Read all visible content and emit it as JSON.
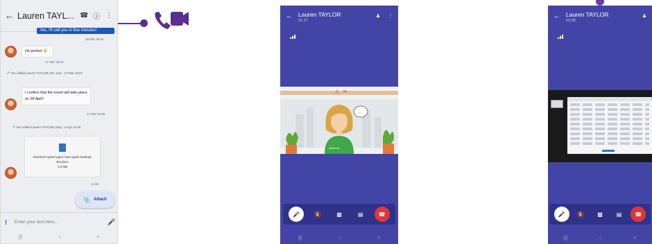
{
  "colors": {
    "brand_purple": "#5b2e91",
    "call_background": "#4345a6",
    "hangup_red": "#e0353b",
    "accent_blue": "#1d57b8"
  },
  "chat_screen": {
    "header": {
      "title": "Lauren TAYL...",
      "icons": [
        "back-arrow-icon",
        "video-call-icon",
        "info-icon",
        "more-vert-icon"
      ]
    },
    "messages": {
      "outgoing_top": "Yes, I'll call you in five minutes!",
      "outgoing_top_time": "16 Mar 16:31",
      "msg1_text": "Ok perfect",
      "msg1_time": "17 Mar 18:42",
      "sys1": "You called Lauren TAYLOR (3m 12s) - 17 Mar 15:57",
      "msg2_text": "I confirm that the event will take place on 28 April!",
      "msg2_time": "17 Mar 15:58",
      "sys2": "You called Lauren TAYLOR (16s) - 5 Apr 14:16",
      "file_name": "Rainbow hybrid quick start guide desktop EN.docx",
      "file_size": "1.5 MB",
      "file_time": "11:38"
    },
    "attach_label": "Attach",
    "composer_placeholder": "Enter your text here..."
  },
  "callout": {
    "icon": "video-call-icon"
  },
  "video_call_screen": {
    "name": "Lauren TAYLOR",
    "duration": "01:27",
    "video_label": "TSI",
    "watermark": "Rainbow",
    "controls": [
      "microphone-icon",
      "speaker-mute-icon",
      "video-off-icon",
      "chat-icon",
      "hangup-icon"
    ]
  },
  "share_call_screen": {
    "name": "Lauren TAYLOR",
    "duration": "03:38"
  }
}
